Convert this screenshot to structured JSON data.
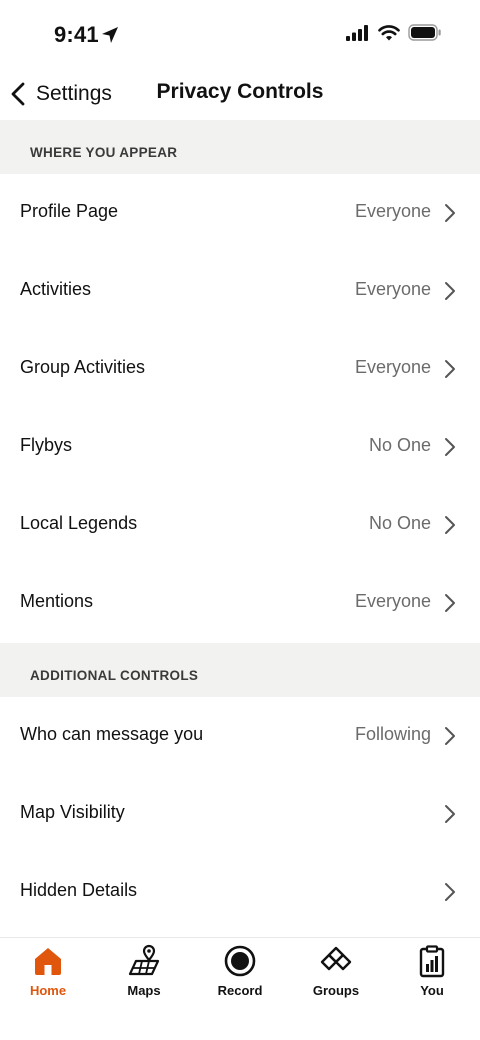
{
  "status_bar": {
    "time": "9:41",
    "icons": [
      "location-arrow-icon",
      "cellular-signal-icon",
      "wifi-icon",
      "battery-icon"
    ]
  },
  "nav": {
    "back_label": "Settings",
    "title": "Privacy Controls"
  },
  "sections": [
    {
      "header": "WHERE YOU APPEAR",
      "rows": [
        {
          "label": "Profile Page",
          "value": "Everyone"
        },
        {
          "label": "Activities",
          "value": "Everyone"
        },
        {
          "label": "Group Activities",
          "value": "Everyone"
        },
        {
          "label": "Flybys",
          "value": "No One"
        },
        {
          "label": "Local Legends",
          "value": "No One"
        },
        {
          "label": "Mentions",
          "value": "Everyone"
        }
      ]
    },
    {
      "header": "ADDITIONAL CONTROLS",
      "rows": [
        {
          "label": "Who can message you",
          "value": "Following"
        },
        {
          "label": "Map Visibility",
          "value": ""
        },
        {
          "label": "Hidden Details",
          "value": ""
        }
      ]
    }
  ],
  "tab_bar": {
    "tabs": [
      {
        "label": "Home",
        "icon": "home-icon",
        "active": true
      },
      {
        "label": "Maps",
        "icon": "maps-icon",
        "active": false
      },
      {
        "label": "Record",
        "icon": "record-icon",
        "active": false
      },
      {
        "label": "Groups",
        "icon": "groups-icon",
        "active": false
      },
      {
        "label": "You",
        "icon": "you-icon",
        "active": false
      }
    ]
  },
  "colors": {
    "accent": "#e0560c",
    "section_bg": "#f2f2f0",
    "secondary_text": "#6b6b6b"
  }
}
